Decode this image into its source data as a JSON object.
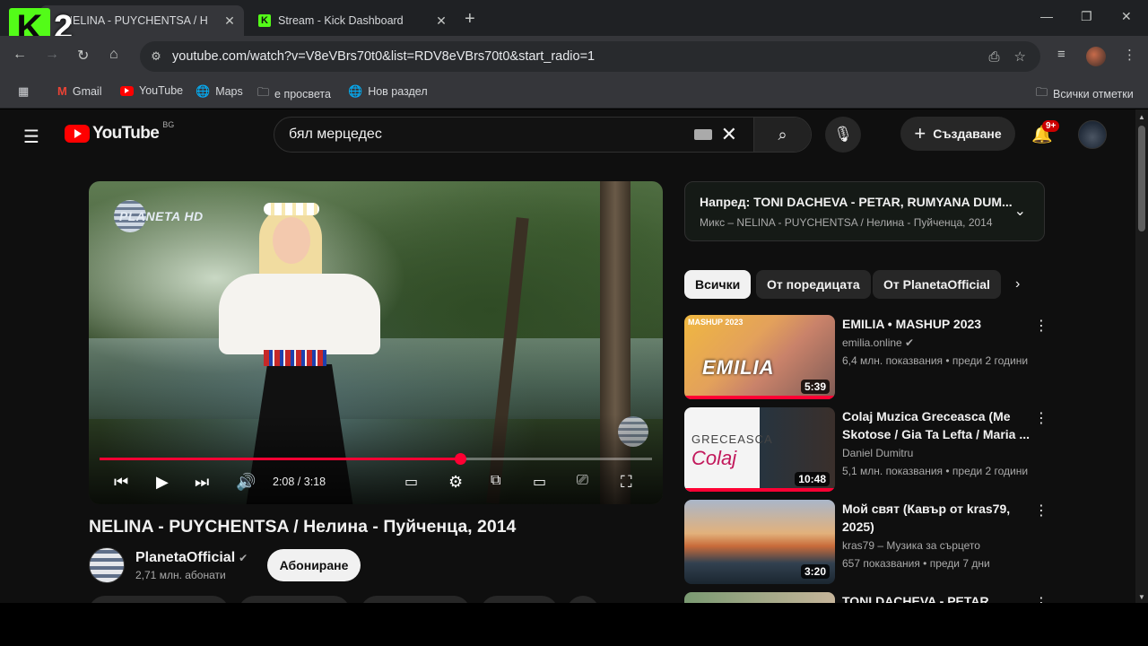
{
  "browser": {
    "tabs": [
      {
        "title": "NELINA - PUYCHENTSA / Н",
        "active": true
      },
      {
        "title": "Stream - Kick Dashboard",
        "active": false
      }
    ],
    "url": "youtube.com/watch?v=V8eVBrs70t0&list=RDV8eVBrs70t0&start_radio=1",
    "bookmarks": [
      "Gmail",
      "YouTube",
      "Maps",
      "е просвета",
      "Нов раздел"
    ],
    "all_bookmarks": "Всички отметки",
    "overlay_digit": "2"
  },
  "youtube": {
    "logo_text": "YouTube",
    "country": "BG",
    "search_query": "бял мерцедес",
    "create_label": "Създаване",
    "notif_badge": "9+",
    "player": {
      "watermark": "PLANETA HD",
      "time": "2:08 / 3:18",
      "progress": 0.653
    },
    "video_title": "NELINA - PUYCHENTSA / Нелина - Пуйченца, 2014",
    "channel": {
      "name": "PlanetaOfficial",
      "subs": "2,71 млн. абонати"
    },
    "subscribe_label": "Абониране",
    "mix": {
      "next": "Напред: TONI DACHEVA - PETAR, RUMYANA DUM...",
      "subtitle": "Микс – NELINA - PUYCHENTSA / Нелина - Пуйченца, 2014"
    },
    "chips": [
      "Всички",
      "От поредицата",
      "От PlanetaOfficial"
    ],
    "recs": [
      {
        "title": "EMILIA • MASHUP 2023",
        "channel": "emilia.online",
        "meta": "6,4 млн. показвания  •  преди 2 години",
        "duration": "5:39",
        "thumb_tag": "MASHUP 2023",
        "thumb_text": "EMILIA"
      },
      {
        "title": "Colaj Muzica Greceasca (Me Skotose / Gia Ta Lefta / Maria ...",
        "channel": "Daniel Dumitru",
        "meta": "5,1 млн. показвания  •  преди 2 години",
        "duration": "10:48",
        "thumb_tag": "GRECEASCA",
        "thumb_text": "Colaj"
      },
      {
        "title": "Мой свят (Кавър от kras79, 2025)",
        "channel": "kras79 – Музика за сърцето",
        "meta": "657 показвания  •  преди 7 дни",
        "duration": "3:20"
      },
      {
        "title": "TONI DACHEVA - PETAR",
        "channel": "",
        "meta": "",
        "duration": ""
      }
    ]
  }
}
